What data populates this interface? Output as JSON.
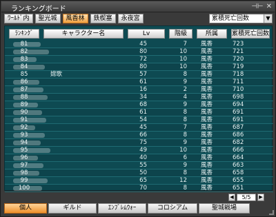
{
  "window": {
    "title": "ランキングボード",
    "btn_pin": "⊣⊢",
    "btn_close": "✕"
  },
  "tabs": [
    "ﾜｰﾙﾄﾞ内",
    "聖光城",
    "風香林",
    "鉄楔塞",
    "永夜宮"
  ],
  "active_tab": 2,
  "sort_select": {
    "value": "累積死亡回数",
    "arrow": "▼"
  },
  "table": {
    "headers": [
      "ﾗﾝｷﾝｸﾞ",
      "キャラクター名",
      "Lv",
      "階級",
      "所属",
      "累積死亡回数"
    ],
    "rows": [
      {
        "rank": "81",
        "name": "",
        "lv": "45",
        "cls": "7",
        "aff": "風香",
        "deaths": "723"
      },
      {
        "rank": "82",
        "name": "",
        "lv": "80",
        "cls": "10",
        "aff": "風香",
        "deaths": "721"
      },
      {
        "rank": "83",
        "name": "",
        "lv": "72",
        "cls": "10",
        "aff": "風香",
        "deaths": "720"
      },
      {
        "rank": "84",
        "name": "",
        "lv": "80",
        "cls": "10",
        "aff": "風香",
        "deaths": "719"
      },
      {
        "rank": "85",
        "name": "嫦歌",
        "lv": "57",
        "cls": "8",
        "aff": "風香",
        "deaths": "718"
      },
      {
        "rank": "86",
        "name": "",
        "lv": "61",
        "cls": "9",
        "aff": "風香",
        "deaths": "711"
      },
      {
        "rank": "87",
        "name": "",
        "lv": "16",
        "cls": "2",
        "aff": "風香",
        "deaths": "710"
      },
      {
        "rank": "88",
        "name": "",
        "lv": "34",
        "cls": "4",
        "aff": "風香",
        "deaths": "698"
      },
      {
        "rank": "89",
        "name": "",
        "lv": "68",
        "cls": "9",
        "aff": "風香",
        "deaths": "694"
      },
      {
        "rank": "90",
        "name": "",
        "lv": "61",
        "cls": "8",
        "aff": "風香",
        "deaths": "691"
      },
      {
        "rank": "91",
        "name": "",
        "lv": "54",
        "cls": "8",
        "aff": "風香",
        "deaths": "691"
      },
      {
        "rank": "92",
        "name": "",
        "lv": "45",
        "cls": "7",
        "aff": "風香",
        "deaths": "687"
      },
      {
        "rank": "93",
        "name": "",
        "lv": "66",
        "cls": "8",
        "aff": "風香",
        "deaths": "686"
      },
      {
        "rank": "94",
        "name": "",
        "lv": "75",
        "cls": "9",
        "aff": "風香",
        "deaths": "682"
      },
      {
        "rank": "95",
        "name": "",
        "lv": "49",
        "cls": "10",
        "aff": "風香",
        "deaths": "666"
      },
      {
        "rank": "96",
        "name": "",
        "lv": "40",
        "cls": "6",
        "aff": "風香",
        "deaths": "664"
      },
      {
        "rank": "97",
        "name": "",
        "lv": "55",
        "cls": "9",
        "aff": "風香",
        "deaths": "663"
      },
      {
        "rank": "98",
        "name": "",
        "lv": "50",
        "cls": "8",
        "aff": "風香",
        "deaths": "658"
      },
      {
        "rank": "99",
        "name": "",
        "lv": "65",
        "cls": "12",
        "aff": "風香",
        "deaths": "655"
      },
      {
        "rank": "100",
        "name": "",
        "lv": "70",
        "cls": "8",
        "aff": "風香",
        "deaths": "651"
      }
    ]
  },
  "pager": {
    "prev": "◀",
    "page": "5/5",
    "next": "▶"
  },
  "bottom_tabs": [
    "個人",
    "ギルド",
    "ｴﾝﾌﾞﾚﾑｳｫｰ",
    "コロシアム",
    "聖城戦場"
  ],
  "active_bottom_tab": 0,
  "colors": {
    "board_bg": "#0e4a52",
    "active_tab": "#f0a040",
    "row_line": "#1f6b73"
  }
}
